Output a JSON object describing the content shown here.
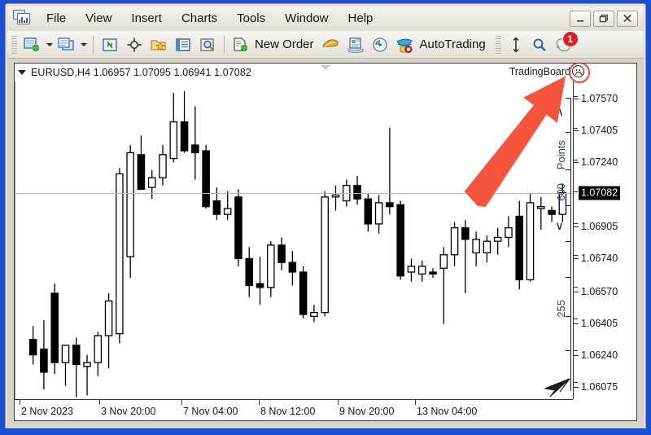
{
  "window": {
    "app_icon": "mt-chart-icon",
    "controls": {
      "minimize": "minimize-icon",
      "restore": "restore-icon",
      "close": "close-icon"
    }
  },
  "menu": {
    "items": [
      {
        "label": "File",
        "name": "menu-file"
      },
      {
        "label": "View",
        "name": "menu-view"
      },
      {
        "label": "Insert",
        "name": "menu-insert"
      },
      {
        "label": "Charts",
        "name": "menu-charts"
      },
      {
        "label": "Tools",
        "name": "menu-tools"
      },
      {
        "label": "Window",
        "name": "menu-window"
      },
      {
        "label": "Help",
        "name": "menu-help"
      }
    ]
  },
  "toolbar": {
    "new_chart_icon": "new-chart-icon",
    "profiles_icon": "profiles-icon",
    "indicators_icon": "indicators-icon",
    "crosshair_icon": "crosshair-icon",
    "templates_icon": "templates-icon",
    "data_window_icon": "data-window-icon",
    "zoom_region_icon": "zoom-region-icon",
    "new_order_icon": "new-order-icon",
    "new_order_label": "New Order",
    "metaeditor_icon": "metaeditor-icon",
    "news_icon": "news-icon",
    "signals_icon": "signals-icon",
    "autotrading_icon": "autotrading-icon",
    "autotrading_label": "AutoTrading",
    "fit_vertical_icon": "fit-vertical-icon",
    "zoom_icon": "magnifier-icon",
    "alerts_icon": "alerts-icon",
    "alerts_badge": "1"
  },
  "chart": {
    "symbol_line": "EURUSD,H4  1.06957 1.07095 1.06941 1.07082",
    "symbol": "EURUSD",
    "timeframe": "H4",
    "ohlc": {
      "open": "1.06957",
      "high": "1.07095",
      "low": "1.06941",
      "close": "1.07082"
    },
    "indicator_label": "TradingBoard",
    "indicator_status_icon": "sad-face-icon",
    "collapse_icon": "chart-collapse-icon",
    "shift_icon": "chart-shift-arrow-icon",
    "highlight_color": "#f24a33",
    "callout_arrow_color": "#f4553c",
    "price_line_value": "1.07082",
    "points_gadget": {
      "up_icon": "scale-up-arrow",
      "label": "Points",
      "value": "600",
      "down_icon": "scale-down-arrow",
      "secondary_value": "255"
    }
  },
  "chart_data": {
    "type": "candlestick",
    "title": "EURUSD,H4",
    "xlabel": "",
    "ylabel": "",
    "ylim": [
      1.0601,
      1.0766
    ],
    "price_axis_ticks": [
      "1.07570",
      "1.07405",
      "1.07240",
      "1.06905",
      "1.06740",
      "1.06570",
      "1.06405",
      "1.06240",
      "1.06075"
    ],
    "current_price": "1.07082",
    "time_axis_ticks": [
      "2 Nov 2023",
      "3 Nov 20:00",
      "7 Nov 04:00",
      "8 Nov 12:00",
      "9 Nov 20:00",
      "13 Nov 04:00"
    ],
    "candles": [
      {
        "o": 1.0632,
        "h": 1.0639,
        "l": 1.0619,
        "c": 1.0624,
        "d": 1
      },
      {
        "o": 1.0627,
        "h": 1.0642,
        "l": 1.0606,
        "c": 1.0615,
        "d": 1
      },
      {
        "o": 1.0656,
        "h": 1.0661,
        "l": 1.0614,
        "c": 1.062,
        "d": 1
      },
      {
        "o": 1.062,
        "h": 1.0626,
        "l": 1.0608,
        "c": 1.0629,
        "d": 0
      },
      {
        "o": 1.0629,
        "h": 1.0633,
        "l": 1.0602,
        "c": 1.0619,
        "d": 1
      },
      {
        "o": 1.0618,
        "h": 1.0624,
        "l": 1.0603,
        "c": 1.062,
        "d": 0
      },
      {
        "o": 1.062,
        "h": 1.0636,
        "l": 1.0613,
        "c": 1.0634,
        "d": 0
      },
      {
        "o": 1.0634,
        "h": 1.0656,
        "l": 1.0617,
        "c": 1.0652,
        "d": 0
      },
      {
        "o": 1.0635,
        "h": 1.0721,
        "l": 1.063,
        "c": 1.0718,
        "d": 0
      },
      {
        "o": 1.0675,
        "h": 1.0733,
        "l": 1.0664,
        "c": 1.0729,
        "d": 0
      },
      {
        "o": 1.0728,
        "h": 1.0738,
        "l": 1.0718,
        "c": 1.071,
        "d": 1
      },
      {
        "o": 1.0711,
        "h": 1.072,
        "l": 1.0705,
        "c": 1.0716,
        "d": 0
      },
      {
        "o": 1.0716,
        "h": 1.0733,
        "l": 1.0712,
        "c": 1.0728,
        "d": 0
      },
      {
        "o": 1.0726,
        "h": 1.076,
        "l": 1.0724,
        "c": 1.0745,
        "d": 0
      },
      {
        "o": 1.0745,
        "h": 1.0761,
        "l": 1.0729,
        "c": 1.073,
        "d": 1
      },
      {
        "o": 1.0733,
        "h": 1.0753,
        "l": 1.0715,
        "c": 1.0729,
        "d": 1
      },
      {
        "o": 1.073,
        "h": 1.0733,
        "l": 1.07,
        "c": 1.0701,
        "d": 1
      },
      {
        "o": 1.0704,
        "h": 1.0711,
        "l": 1.0694,
        "c": 1.0697,
        "d": 1
      },
      {
        "o": 1.0697,
        "h": 1.0709,
        "l": 1.0694,
        "c": 1.07,
        "d": 0
      },
      {
        "o": 1.0706,
        "h": 1.071,
        "l": 1.067,
        "c": 1.0674,
        "d": 1
      },
      {
        "o": 1.0674,
        "h": 1.068,
        "l": 1.0654,
        "c": 1.066,
        "d": 1
      },
      {
        "o": 1.0661,
        "h": 1.0675,
        "l": 1.065,
        "c": 1.0659,
        "d": 1
      },
      {
        "o": 1.0659,
        "h": 1.0683,
        "l": 1.0654,
        "c": 1.0681,
        "d": 0
      },
      {
        "o": 1.0681,
        "h": 1.0685,
        "l": 1.0668,
        "c": 1.0672,
        "d": 1
      },
      {
        "o": 1.0672,
        "h": 1.0678,
        "l": 1.066,
        "c": 1.0667,
        "d": 1
      },
      {
        "o": 1.0667,
        "h": 1.067,
        "l": 1.0643,
        "c": 1.0645,
        "d": 1
      },
      {
        "o": 1.0646,
        "h": 1.065,
        "l": 1.0641,
        "c": 1.0644,
        "d": 0
      },
      {
        "o": 1.0646,
        "h": 1.0709,
        "l": 1.0644,
        "c": 1.0706,
        "d": 0
      },
      {
        "o": 1.0706,
        "h": 1.0712,
        "l": 1.0699,
        "c": 1.0707,
        "d": 0
      },
      {
        "o": 1.0704,
        "h": 1.0715,
        "l": 1.0701,
        "c": 1.0712,
        "d": 0
      },
      {
        "o": 1.0712,
        "h": 1.0717,
        "l": 1.0702,
        "c": 1.0705,
        "d": 1
      },
      {
        "o": 1.0705,
        "h": 1.0708,
        "l": 1.0688,
        "c": 1.0692,
        "d": 1
      },
      {
        "o": 1.0692,
        "h": 1.0707,
        "l": 1.0687,
        "c": 1.0703,
        "d": 0
      },
      {
        "o": 1.0703,
        "h": 1.0742,
        "l": 1.0697,
        "c": 1.0701,
        "d": 1
      },
      {
        "o": 1.0702,
        "h": 1.0704,
        "l": 1.0663,
        "c": 1.0665,
        "d": 1
      },
      {
        "o": 1.0667,
        "h": 1.0674,
        "l": 1.0662,
        "c": 1.067,
        "d": 0
      },
      {
        "o": 1.067,
        "h": 1.0673,
        "l": 1.0662,
        "c": 1.0666,
        "d": 0
      },
      {
        "o": 1.0666,
        "h": 1.0669,
        "l": 1.0664,
        "c": 1.0667,
        "d": 1
      },
      {
        "o": 1.0669,
        "h": 1.068,
        "l": 1.064,
        "c": 1.0676,
        "d": 0
      },
      {
        "o": 1.0676,
        "h": 1.0693,
        "l": 1.067,
        "c": 1.069,
        "d": 0
      },
      {
        "o": 1.069,
        "h": 1.0694,
        "l": 1.0656,
        "c": 1.0684,
        "d": 1
      },
      {
        "o": 1.0684,
        "h": 1.0688,
        "l": 1.067,
        "c": 1.0677,
        "d": 0
      },
      {
        "o": 1.0677,
        "h": 1.0686,
        "l": 1.0672,
        "c": 1.0683,
        "d": 0
      },
      {
        "o": 1.0683,
        "h": 1.069,
        "l": 1.0676,
        "c": 1.0685,
        "d": 0
      },
      {
        "o": 1.0685,
        "h": 1.0696,
        "l": 1.068,
        "c": 1.069,
        "d": 0
      },
      {
        "o": 1.0696,
        "h": 1.0704,
        "l": 1.0658,
        "c": 1.0663,
        "d": 1
      },
      {
        "o": 1.0663,
        "h": 1.0708,
        "l": 1.0662,
        "c": 1.0703,
        "d": 0
      },
      {
        "o": 1.0701,
        "h": 1.0706,
        "l": 1.0689,
        "c": 1.07,
        "d": 0
      },
      {
        "o": 1.0699,
        "h": 1.0701,
        "l": 1.0693,
        "c": 1.0697,
        "d": 1
      },
      {
        "o": 1.0697,
        "h": 1.0713,
        "l": 1.0693,
        "c": 1.07082,
        "d": 0
      }
    ]
  }
}
